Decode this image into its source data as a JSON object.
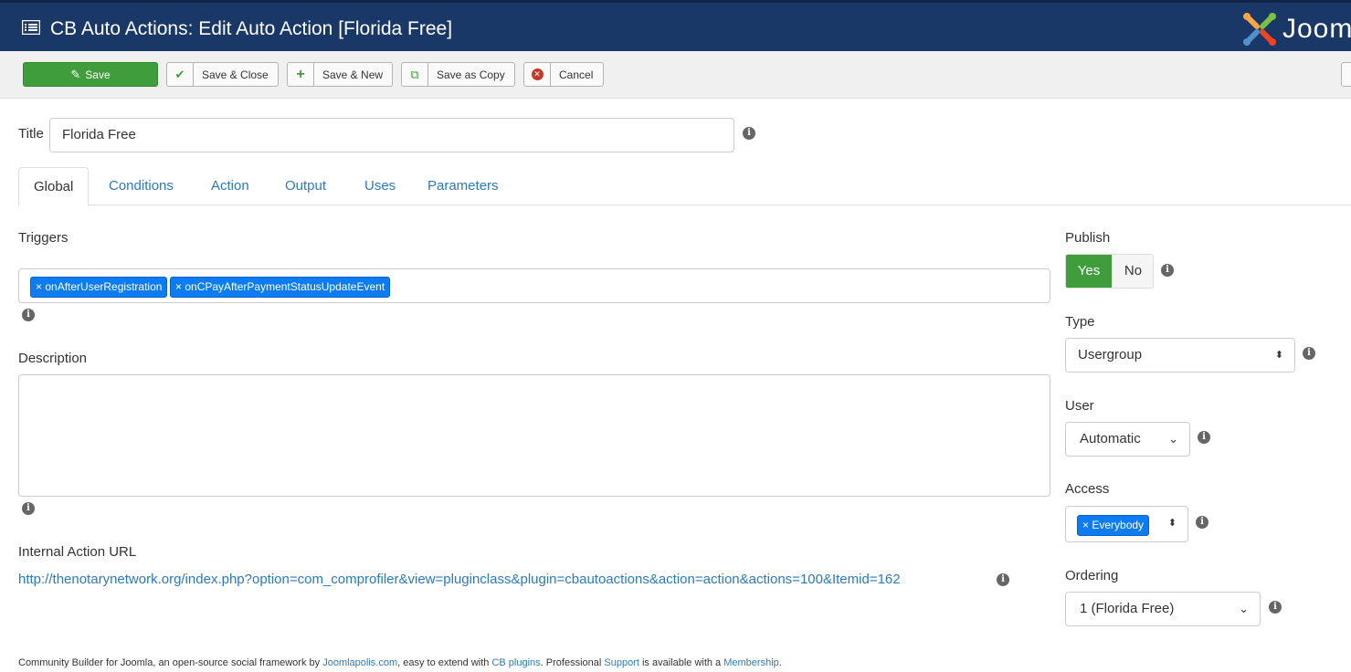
{
  "header": {
    "title": "CB Auto Actions: Edit Auto Action [Florida Free]",
    "brand": "Joomla!",
    "brand_visible": "Jooml"
  },
  "toolbar": {
    "save": "Save",
    "save_close": "Save & Close",
    "save_new": "Save & New",
    "save_copy": "Save as Copy",
    "cancel": "Cancel"
  },
  "form": {
    "title_label": "Title",
    "title_value": "Florida Free",
    "tabs": [
      "Global",
      "Conditions",
      "Action",
      "Output",
      "Uses",
      "Parameters"
    ],
    "triggers_label": "Triggers",
    "triggers": [
      "onAfterUserRegistration",
      "onCPayAfterPaymentStatusUpdateEvent"
    ],
    "description_label": "Description",
    "description_value": "",
    "url_label": "Internal Action URL",
    "url_value": "http://thenotarynetwork.org/index.php?option=com_comprofiler&view=pluginclass&plugin=cbautoactions&action=action&actions=100&Itemid=162"
  },
  "sidebar": {
    "publish_label": "Publish",
    "publish_yes": "Yes",
    "publish_no": "No",
    "type_label": "Type",
    "type_value": "Usergroup",
    "user_label": "User",
    "user_value": "Automatic",
    "access_label": "Access",
    "access_value": "Everybody",
    "ordering_label": "Ordering",
    "ordering_value": "1 (Florida Free)"
  },
  "footer": {
    "text1": "Community Builder for Joomla, an open-source social framework by ",
    "link1": "Joomlapolis.com",
    "text2": ", easy to extend with ",
    "link2": "CB plugins",
    "text3": ". Professional ",
    "link3": "Support",
    "text4": " is available with a ",
    "link4": "Membership",
    "text5": "."
  },
  "colors": {
    "header_bg": "#1a3867",
    "save_green": "#3f9d3c",
    "chip_blue": "#0d7cf2",
    "link_blue": "#2b79c2"
  }
}
